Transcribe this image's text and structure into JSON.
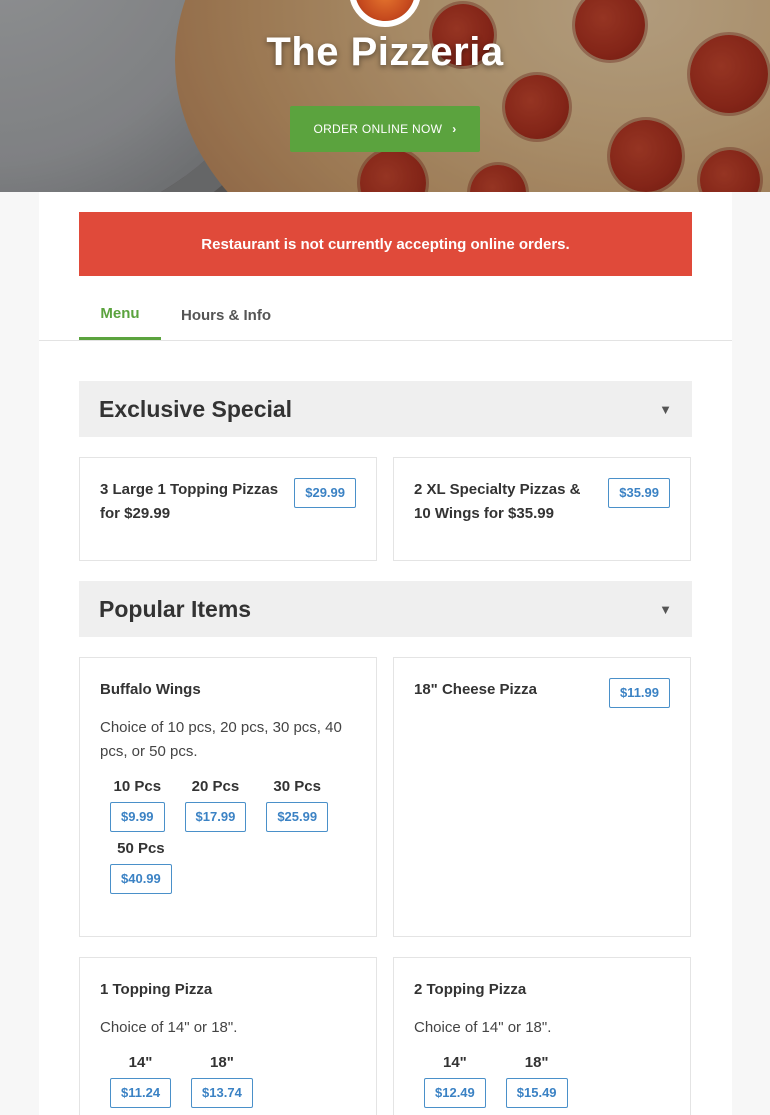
{
  "hero": {
    "title": "The Pizzeria",
    "order_button": "ORDER ONLINE NOW",
    "order_chevron": "›"
  },
  "alert": {
    "message": "Restaurant is not currently accepting online orders."
  },
  "tabs": [
    {
      "label": "Menu",
      "active": true
    },
    {
      "label": "Hours & Info",
      "active": false
    }
  ],
  "sections": {
    "exclusive": {
      "title": "Exclusive Special",
      "caret": "▼",
      "items": [
        {
          "name": "3 Large 1 Topping Pizzas for $29.99",
          "price": "$29.99"
        },
        {
          "name": "2 XL Specialty Pizzas & 10 Wings for $35.99",
          "price": "$35.99"
        }
      ]
    },
    "popular": {
      "title": "Popular Items",
      "caret": "▼",
      "items": [
        {
          "name": "Buffalo Wings",
          "description": "Choice of 10 pcs, 20 pcs, 30 pcs, 40 pcs, or 50 pcs.",
          "options": [
            {
              "label": "10 Pcs",
              "price": "$9.99"
            },
            {
              "label": "20 Pcs",
              "price": "$17.99"
            },
            {
              "label": "30 Pcs",
              "price": "$25.99"
            },
            {
              "label": "50 Pcs",
              "price": "$40.99"
            }
          ]
        },
        {
          "name": "18\" Cheese Pizza",
          "price": "$11.99"
        },
        {
          "name": "1 Topping Pizza",
          "description": "Choice of 14\" or 18\".",
          "options": [
            {
              "label": "14\"",
              "price": "$11.24"
            },
            {
              "label": "18\"",
              "price": "$13.74"
            }
          ]
        },
        {
          "name": "2 Topping Pizza",
          "description": "Choice of 14\" or 18\".",
          "options": [
            {
              "label": "14\"",
              "price": "$12.49"
            },
            {
              "label": "18\"",
              "price": "$15.49"
            }
          ]
        }
      ]
    }
  },
  "colors": {
    "accent_green": "#5ba33e",
    "alert_red": "#e04a3a",
    "price_blue": "#3b82c4"
  }
}
